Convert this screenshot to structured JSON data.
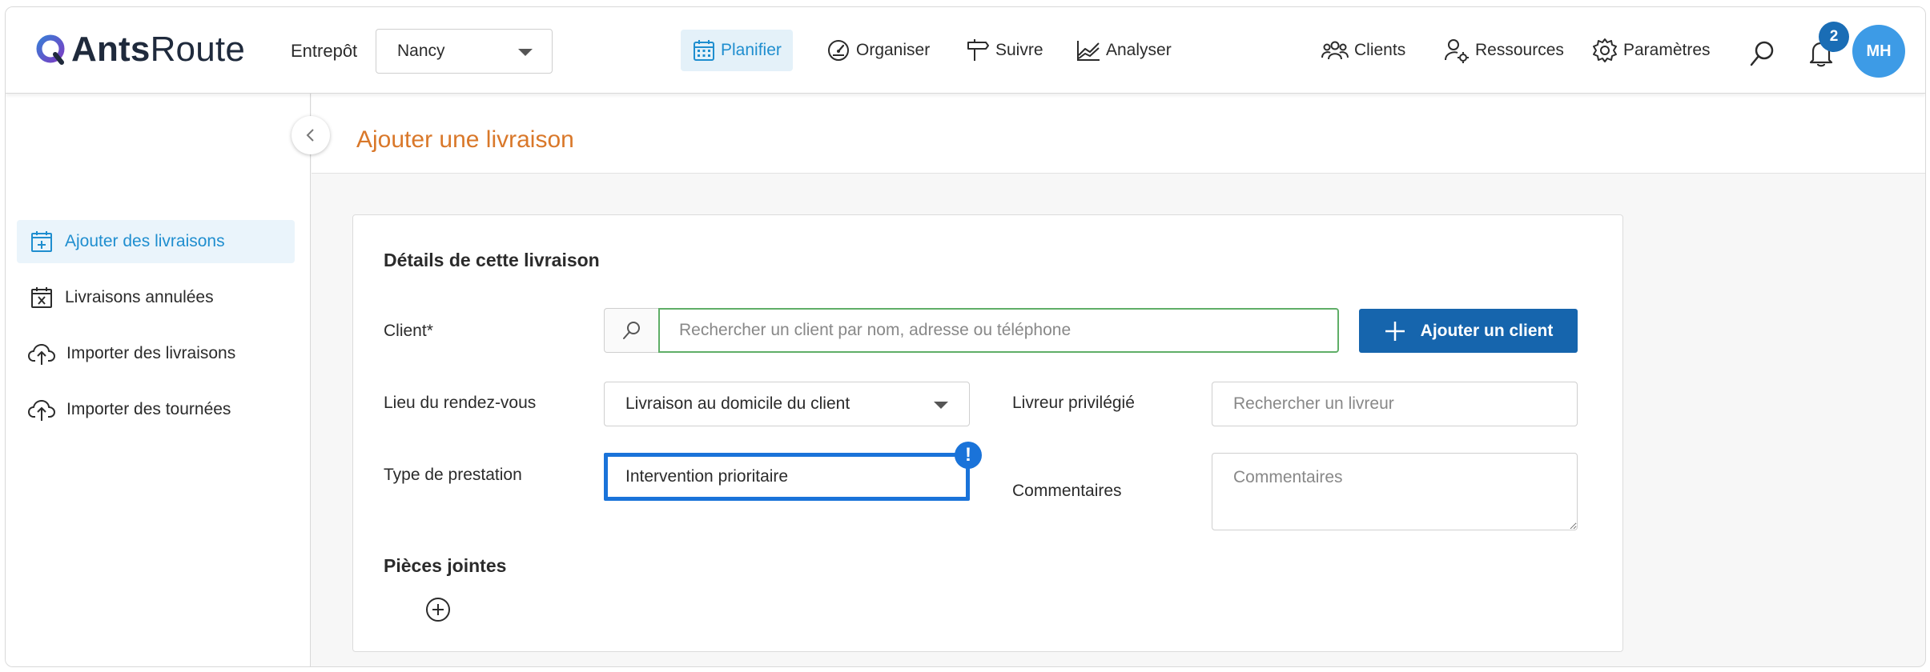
{
  "app": {
    "logo_bold": "Ants",
    "logo_light": "Route"
  },
  "header": {
    "warehouse_label": "Entrepôt",
    "warehouse_value": "Nancy",
    "nav": [
      {
        "label": "Planifier",
        "icon": "calendar-icon",
        "active": true
      },
      {
        "label": "Organiser",
        "icon": "gauge-icon",
        "active": false
      },
      {
        "label": "Suivre",
        "icon": "signpost-icon",
        "active": false
      },
      {
        "label": "Analyser",
        "icon": "chart-icon",
        "active": false
      }
    ],
    "right_nav": [
      {
        "label": "Clients",
        "icon": "users-icon"
      },
      {
        "label": "Ressources",
        "icon": "user-gear-icon"
      },
      {
        "label": "Paramètres",
        "icon": "gear-icon"
      }
    ],
    "notification_count": "2",
    "avatar_initials": "MH",
    "colors": {
      "accent": "#1f8ecf",
      "brand_blue": "#1665ad",
      "title_orange": "#d9782a"
    }
  },
  "sidebar": {
    "items": [
      {
        "label": "Ajouter des livraisons",
        "icon": "calendar-add-icon",
        "active": true
      },
      {
        "label": "Livraisons annulées",
        "icon": "calendar-cancel-icon",
        "active": false
      },
      {
        "label": "Importer des livraisons",
        "icon": "cloud-upload-icon",
        "active": false
      },
      {
        "label": "Importer des tournées",
        "icon": "cloud-upload-icon",
        "active": false
      }
    ]
  },
  "page": {
    "title": "Ajouter une livraison"
  },
  "form": {
    "section_title": "Détails de cette livraison",
    "client_label": "Client*",
    "client_placeholder": "Rechercher un client par nom, adresse ou téléphone",
    "add_client_label": "Ajouter un client",
    "location_label": "Lieu du rendez-vous",
    "location_value": "Livraison au domicile du client",
    "driver_label": "Livreur privilégié",
    "driver_placeholder": "Rechercher un livreur",
    "service_type_label": "Type de prestation",
    "service_type_value": "Intervention prioritaire",
    "service_type_alert": "!",
    "comments_label": "Commentaires",
    "comments_placeholder": "Commentaires",
    "attachments_title": "Pièces jointes"
  }
}
